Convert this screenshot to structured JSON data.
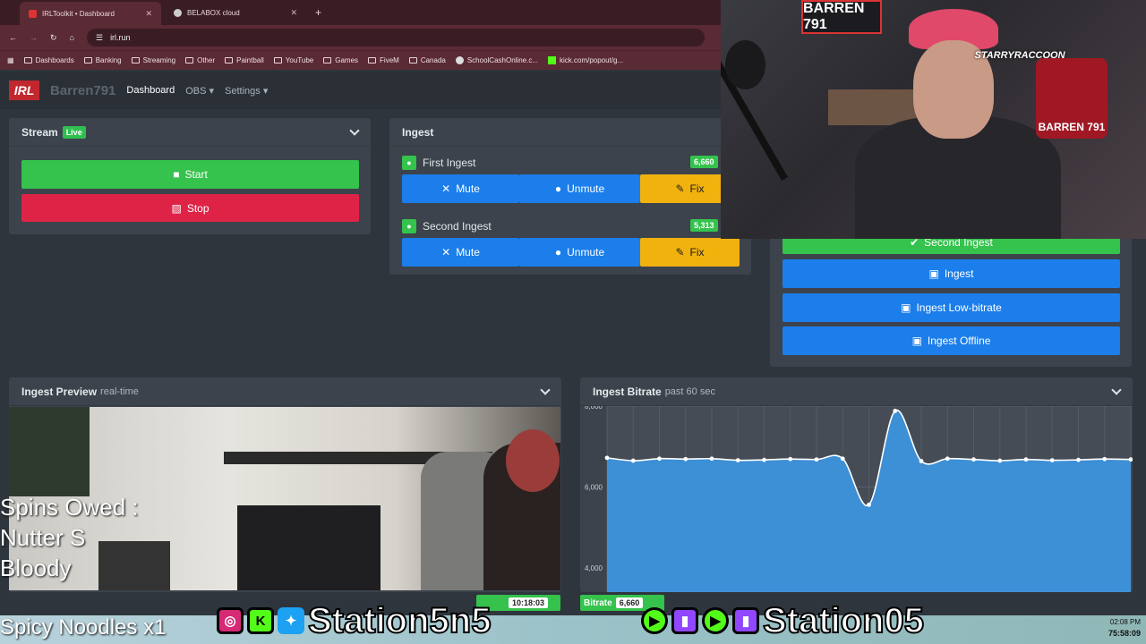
{
  "browser": {
    "tabs": [
      {
        "title": "IRLToolkit • Dashboard",
        "active": true,
        "color": "#d33"
      },
      {
        "title": "BELABOX cloud",
        "active": false,
        "color": "#ccc"
      }
    ],
    "new_tab": "+",
    "url": "irl.run",
    "bookmarks": [
      "Dashboards",
      "Banking",
      "Streaming",
      "Other",
      "Paintball",
      "YouTube",
      "Games",
      "FiveM",
      "Canada",
      "SchoolCashOnline.c...",
      "kick.com/popout/g..."
    ]
  },
  "nav": {
    "logo": "IRL",
    "brand": "Barren791",
    "links": [
      "Dashboard",
      "OBS ▾",
      "Settings ▾"
    ]
  },
  "stream": {
    "title": "Stream",
    "badge": "Live",
    "start": "Start",
    "stop": "Stop"
  },
  "ingest": {
    "title": "Ingest",
    "rows": [
      {
        "name": "First Ingest",
        "bitrate": "6,660",
        "mute": "Mute",
        "unmute": "Unmute",
        "fix": "Fix"
      },
      {
        "name": "Second Ingest",
        "bitrate": "5,313",
        "mute": "Mute",
        "unmute": "Unmute",
        "fix": "Fix"
      }
    ]
  },
  "scenes": {
    "active": "Second Ingest",
    "items": [
      "Ingest",
      "Ingest Low-bitrate",
      "Ingest Offline"
    ]
  },
  "preview": {
    "title": "Ingest Preview",
    "sub": "real-time"
  },
  "bitrate_panel": {
    "title": "Ingest Bitrate",
    "sub": "past 60 sec"
  },
  "chart_data": {
    "type": "line",
    "ytick_labels": [
      "8,000",
      "6,000",
      "4,000"
    ],
    "ylim": [
      3400,
      8000
    ],
    "x": [
      0,
      1,
      2,
      3,
      4,
      5,
      6,
      7,
      8,
      9,
      10,
      11,
      12,
      13,
      14,
      15,
      16,
      17,
      18,
      19,
      20
    ],
    "values": [
      6720,
      6650,
      6700,
      6690,
      6700,
      6660,
      6670,
      6690,
      6680,
      6700,
      5560,
      7880,
      6640,
      6700,
      6680,
      6650,
      6680,
      6660,
      6670,
      6690,
      6680
    ],
    "grid": true,
    "color": "#3d8fd6"
  },
  "webcam": {
    "sign": "BARREN 791",
    "logo": "BARREN 791",
    "raccoon": "STARRYRACCOON"
  },
  "overlay": {
    "spins": "Spins Owed :",
    "nutter": "Nutter S",
    "bloody": "Bloody",
    "noodles": "Spicy Noodles x1",
    "handle_left": "Station5n5",
    "handle_right": "Station05",
    "live_time": "10:18:03",
    "bitrate_label": "Bitrate",
    "bitrate_value": "6,660",
    "clock_time": "02:08 PM",
    "clock_counter": "75:58:09"
  }
}
